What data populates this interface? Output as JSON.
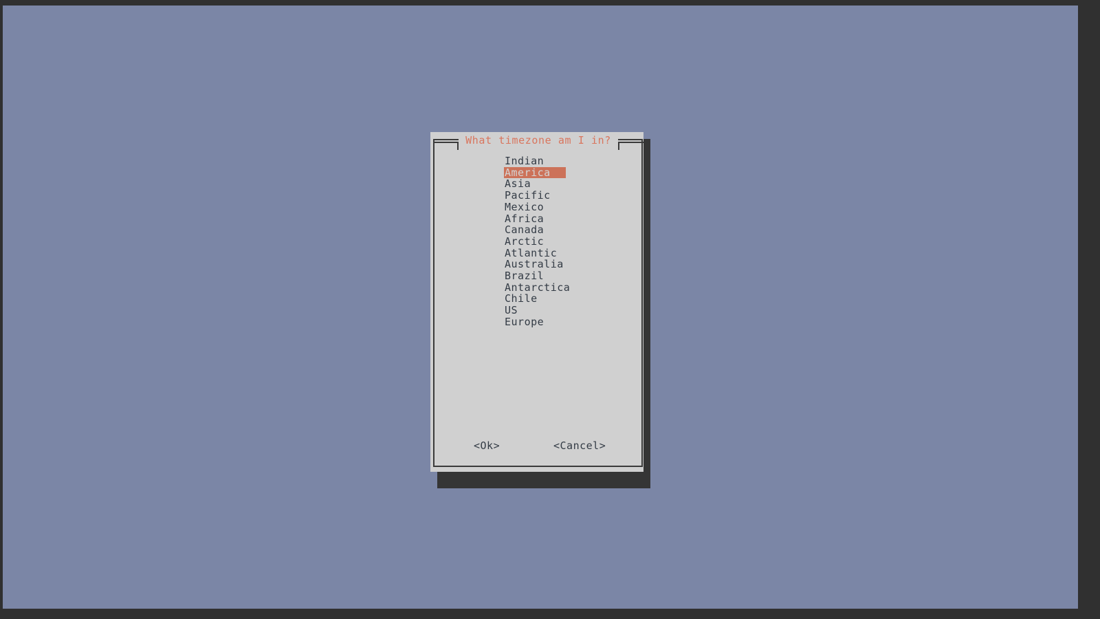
{
  "screen": {
    "background_color": "#303030",
    "desktop_color": "#7b86a6"
  },
  "dialog": {
    "title": "What timezone am I in?",
    "title_color": "#d9755d",
    "panel_color": "#d0d0d0",
    "border_color": "#3a3a3a",
    "text_color": "#333b45",
    "shadow_color": "#353535",
    "highlight_color": "#cc7259",
    "highlight_text_color": "#d4d4d4",
    "menu": {
      "selected_index": 1,
      "items": [
        {
          "label": "Indian"
        },
        {
          "label": "America"
        },
        {
          "label": "Asia"
        },
        {
          "label": "Pacific"
        },
        {
          "label": "Mexico"
        },
        {
          "label": "Africa"
        },
        {
          "label": "Canada"
        },
        {
          "label": "Arctic"
        },
        {
          "label": "Atlantic"
        },
        {
          "label": "Australia"
        },
        {
          "label": "Brazil"
        },
        {
          "label": "Antarctica"
        },
        {
          "label": "Chile"
        },
        {
          "label": "US"
        },
        {
          "label": "Europe"
        }
      ]
    },
    "buttons": {
      "ok": "<Ok>",
      "cancel": "<Cancel>"
    }
  }
}
